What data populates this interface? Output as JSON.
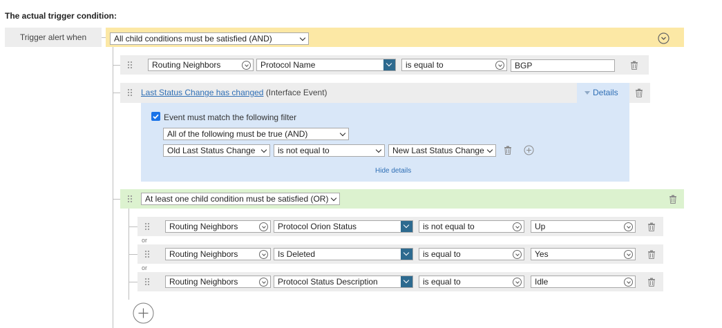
{
  "page_title": "The actual trigger condition:",
  "trigger_label": "Trigger alert when",
  "root_group": {
    "mode": "All child conditions must be satisfied (AND)"
  },
  "condition1": {
    "object": "Routing Neighbors",
    "field": "Protocol Name",
    "operator": "is equal to",
    "value": "BGP"
  },
  "event": {
    "link_text": "Last Status Change has changed",
    "type_text": "(Interface Event)",
    "details_label": "Details",
    "filter_checkbox_label": "Event must match the following filter",
    "filter_checked": true,
    "filter_mode": "All of the following must be true (AND)",
    "filter_field": "Old Last Status Change",
    "filter_operator": "is not equal to",
    "filter_value": "New Last Status Change",
    "hide_details_label": "Hide details"
  },
  "or_group": {
    "mode": "At least one child condition must be satisfied (OR)",
    "or_separator": "or",
    "conditions": [
      {
        "object": "Routing Neighbors",
        "field": "Protocol Orion Status",
        "operator": "is not equal to",
        "value": "Up"
      },
      {
        "object": "Routing Neighbors",
        "field": "Is Deleted",
        "operator": "is equal to",
        "value": "Yes"
      },
      {
        "object": "Routing Neighbors",
        "field": "Protocol Status Description",
        "operator": "is equal to",
        "value": "Idle"
      }
    ]
  },
  "colors": {
    "and_group_bg": "#fce8a5",
    "or_group_bg": "#dcf2cf",
    "event_panel_bg": "#d9e7f8",
    "field_dropdown_accent": "#2d6a8f",
    "link": "#2f6fb5"
  },
  "icons": {
    "drag": "drag-handle-icon",
    "delete": "trash-icon",
    "add": "plus-circle-icon",
    "collapse": "chevron-down-circle-icon"
  }
}
